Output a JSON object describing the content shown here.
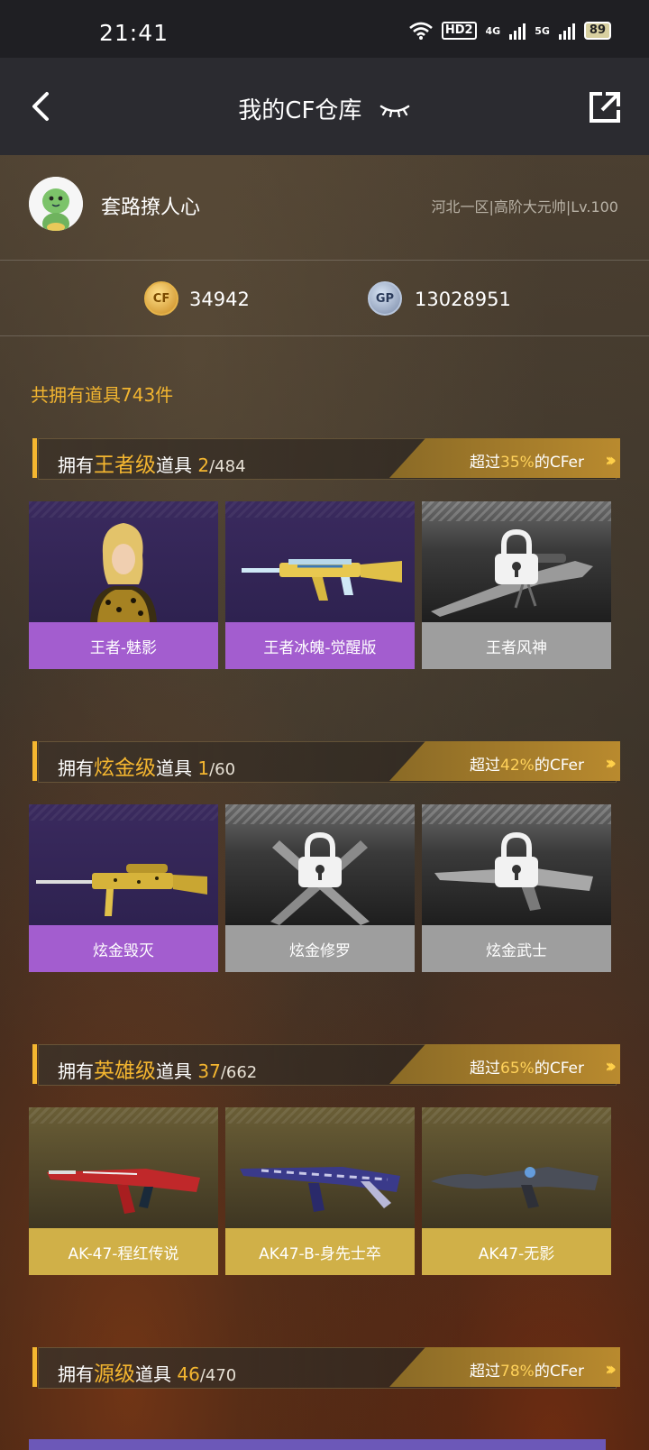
{
  "status_bar": {
    "time": "21:41",
    "hd_tag": "HD2",
    "net1": "4G",
    "net2": "5G",
    "battery": "89"
  },
  "header": {
    "title": "我的CF仓库"
  },
  "profile": {
    "nickname": "套路撩人心",
    "server_info": "河北一区|高阶大元帅|Lv.100"
  },
  "currency": {
    "cf_icon_text": "CF",
    "cf_points": "34942",
    "gp_icon_text": "GP",
    "gp_points": "13028951"
  },
  "total_items": "共拥有道具743件",
  "sections": [
    {
      "prefix": "拥有",
      "tier": "王者级",
      "suffix": "道具",
      "owned": "2",
      "total": "/484",
      "beat_prefix": "超过",
      "beat_pct": "35%",
      "beat_suffix": "的CFer",
      "items": [
        {
          "name": "王者-魅影",
          "locked": false
        },
        {
          "name": "王者冰魄-觉醒版",
          "locked": false
        },
        {
          "name": "王者风神",
          "locked": true
        }
      ]
    },
    {
      "prefix": "拥有",
      "tier": "炫金级",
      "suffix": "道具",
      "owned": "1",
      "total": "/60",
      "beat_prefix": "超过",
      "beat_pct": "42%",
      "beat_suffix": "的CFer",
      "items": [
        {
          "name": "炫金毁灭",
          "locked": false
        },
        {
          "name": "炫金修罗",
          "locked": true
        },
        {
          "name": "炫金武士",
          "locked": true
        }
      ]
    },
    {
      "prefix": "拥有",
      "tier": "英雄级",
      "suffix": "道具",
      "owned": "37",
      "total": "/662",
      "beat_prefix": "超过",
      "beat_pct": "65%",
      "beat_suffix": "的CFer",
      "items": [
        {
          "name": "AK-47-程红传说",
          "locked": false
        },
        {
          "name": "AK47-B-身先士卒",
          "locked": false
        },
        {
          "name": "AK47-无影",
          "locked": false
        }
      ]
    },
    {
      "prefix": "拥有",
      "tier": "源级",
      "suffix": "道具",
      "owned": "46",
      "total": "/470",
      "beat_prefix": "超过",
      "beat_pct": "78%",
      "beat_suffix": "的CFer"
    }
  ],
  "colors": {
    "accent_gold": "#f4b630",
    "owned_label": "#a35dcf",
    "locked_label": "#9e9e9e",
    "hero_label": "#d0b048"
  }
}
